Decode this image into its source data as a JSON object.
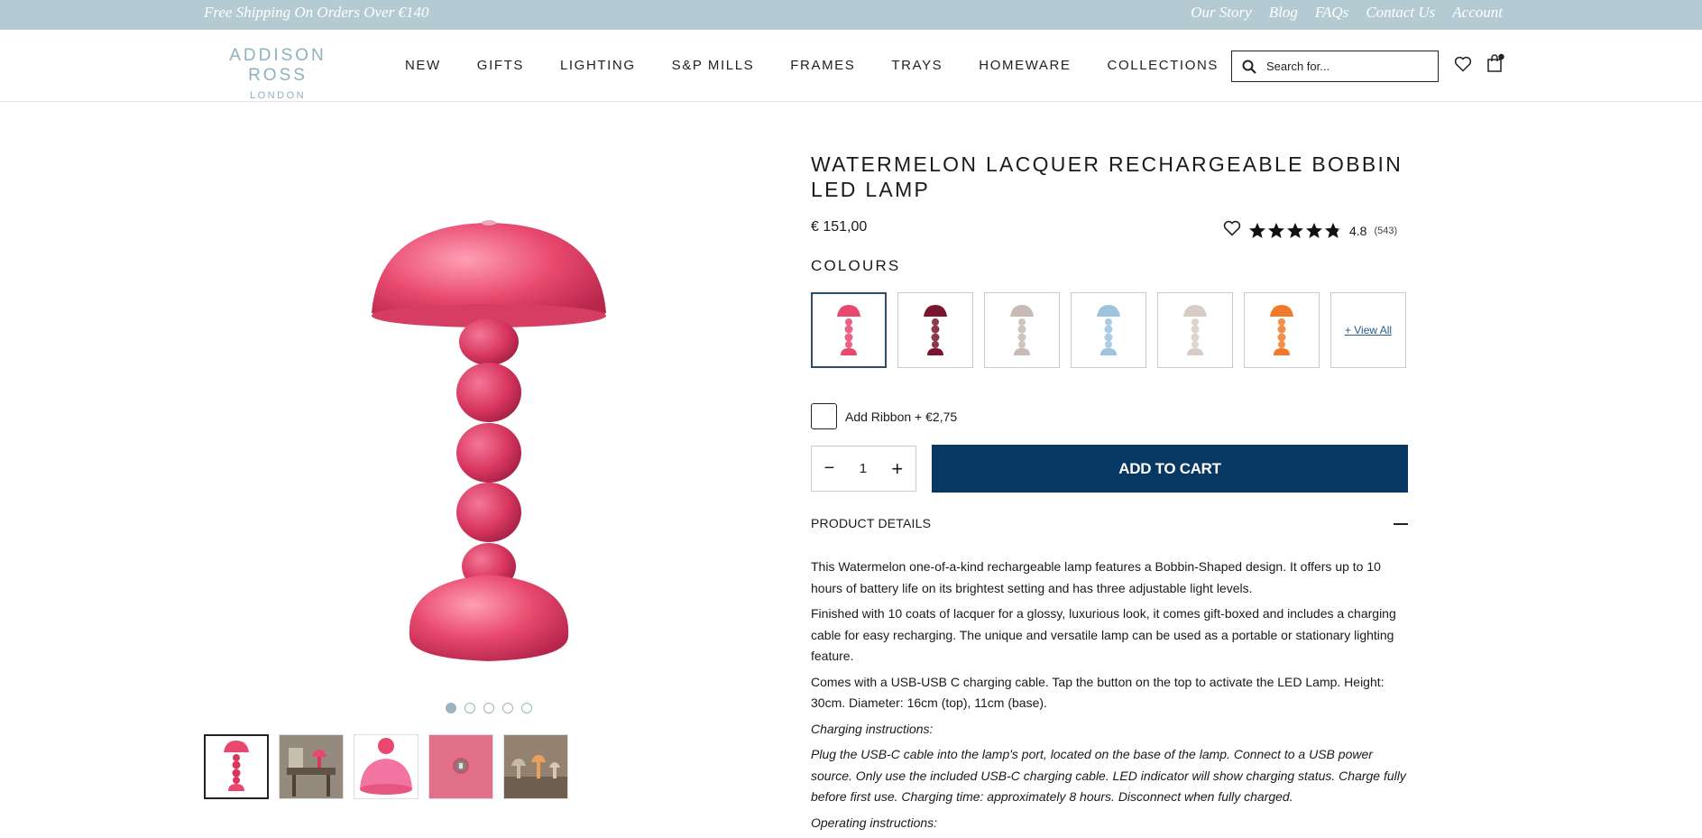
{
  "topbar": {
    "shipping": "Free Shipping On Orders Over €140",
    "links": [
      "Our Story",
      "Blog",
      "FAQs",
      "Contact Us",
      "Account"
    ]
  },
  "logo": {
    "line1": "ADDISON ROSS",
    "line2": "LONDON"
  },
  "nav": [
    "NEW",
    "GIFTS",
    "LIGHTING",
    "S&P MILLS",
    "FRAMES",
    "TRAYS",
    "HOMEWARE",
    "COLLECTIONS"
  ],
  "search": {
    "placeholder": "Search for..."
  },
  "product": {
    "title": "WATERMELON LACQUER RECHARGEABLE BOBBIN LED LAMP",
    "price": "€ 151,00",
    "rating": "4.8",
    "rating_value": 4.8,
    "review_count": "(543)",
    "colours_label": "COLOURS",
    "swatch_colors": [
      "#e8486e",
      "#7a1530",
      "#c8bab4",
      "#9fc2dd",
      "#d8ccc7",
      "#f07a2a"
    ],
    "view_all": "+ View All",
    "ribbon": "Add Ribbon + €2,75",
    "quantity": "1",
    "qty_minus": "−",
    "qty_plus": "+",
    "add_to_cart": "ADD TO CART",
    "details_title": "PRODUCT DETAILS",
    "details": [
      "This Watermelon one-of-a-kind rechargeable lamp features a Bobbin-Shaped design. It offers up to 10 hours of battery life on its brightest setting and has three adjustable light levels.",
      "Finished with 10 coats of lacquer for a glossy, luxurious look, it comes gift-boxed and includes a charging cable for easy recharging. The unique and versatile lamp can be used as a portable or stationary lighting feature.",
      "Comes with a USB-USB C charging cable. Tap the button on the top to activate the LED Lamp. Height: 30cm. Diameter: 16cm (top), 11cm (base).",
      "Charging instructions:",
      "Plug the USB-C cable into the lamp's port, located on the base of the lamp. Connect to a USB power source. Only use the included USB-C charging cable. LED indicator will show charging status. Charge fully before first use. Charging time: approximately 8 hours. Disconnect when fully charged.",
      "Operating instructions:"
    ]
  },
  "gallery": {
    "active_dot": 0,
    "dot_count": 5,
    "thumb_count": 5
  },
  "colors": {
    "topbar": "#b4cbd3",
    "cart": "#073763",
    "lamp": "#e8486e",
    "accent": "#8fb0bd"
  }
}
